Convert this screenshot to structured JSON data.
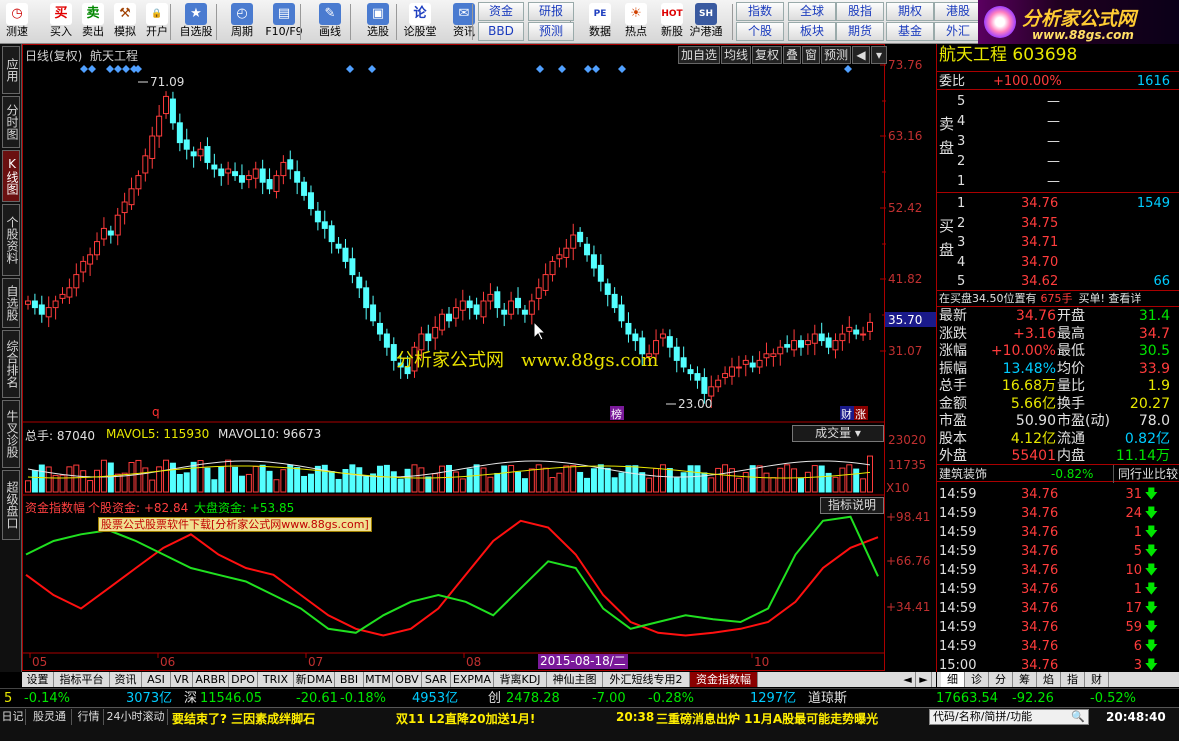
{
  "toolbar": {
    "buttons": [
      {
        "label": "测速",
        "icon": "clock-icon"
      },
      {
        "label": "买入",
        "icon": "buy-icon"
      },
      {
        "label": "卖出",
        "icon": "sell-icon"
      },
      {
        "label": "模拟",
        "icon": "hammer-icon"
      },
      {
        "label": "开户",
        "icon": "lock-icon"
      },
      {
        "label": "自选股",
        "icon": "star-icon"
      },
      {
        "label": "周期",
        "icon": "period-clock-icon"
      },
      {
        "label": "F10/F9",
        "icon": "f10-icon"
      },
      {
        "label": "画线",
        "icon": "pencil-icon"
      },
      {
        "label": "选股",
        "icon": "select-stock-icon"
      },
      {
        "label": "论股堂",
        "icon": "forum-icon"
      },
      {
        "label": "资讯",
        "icon": "news-icon"
      },
      {
        "label": "数据",
        "icon": "pe-icon"
      },
      {
        "label": "热点",
        "icon": "hot-icon"
      },
      {
        "label": "新股",
        "icon": "new-stock-icon"
      },
      {
        "label": "沪港通",
        "icon": "shhk-icon"
      }
    ],
    "small_buttons": [
      "资金",
      "研报",
      "BBD",
      "预测",
      "指数",
      "全球",
      "股指",
      "期权",
      "港股",
      "个股",
      "板块",
      "期货",
      "基金",
      "外汇"
    ],
    "logo_text": "分析家公式网",
    "logo_url": "www.88gs.com"
  },
  "left_tabs": [
    "应用",
    "分时图",
    "K线图",
    "个股资料",
    "自选股",
    "综合排名",
    "牛叉诊股",
    "超级盘口"
  ],
  "chart": {
    "title": "日线(复权)  航天工程",
    "tools": [
      "加自选",
      "均线",
      "复权",
      "叠",
      "窗",
      "预测"
    ],
    "price_axis": [
      "73.76",
      "63.16",
      "52.42",
      "41.82",
      "31.07"
    ],
    "current_price": "35.70",
    "high_label": "71.09",
    "low_label": "23.00",
    "watermark": "分析家公式网   www.88gs.com",
    "markers": {
      "q": "q",
      "bang": "榜",
      "cai": "财",
      "zhang": "涨"
    },
    "volume": {
      "label_total": "总手: 87040",
      "label_ma5": "MAVOL5: 115930",
      "label_ma10": "MAVOL10: 96673",
      "dropdown": "成交量",
      "axis": [
        "23020",
        "11735"
      ],
      "unit": "X10"
    },
    "indicator": {
      "name": "资金指数幅",
      "label_small": "个股资金: +82.84",
      "label_big": "大盘资金: +53.85",
      "button": "指标说明",
      "ad_text": "股票公式股票软件下载[分析家公式网www.88gs.com]",
      "axis": [
        "+98.41",
        "+66.76",
        "+34.41"
      ]
    },
    "x_axis": [
      "05",
      "06",
      "07",
      "08",
      "10"
    ],
    "cursor_date": "2015-08-18/二"
  },
  "chart_data": {
    "type": "line",
    "title": "",
    "ylim": [
      23.0,
      73.76
    ],
    "x": [
      "05",
      "06",
      "07",
      "08",
      "10"
    ],
    "series": [
      {
        "name": "个股资金",
        "values": [
          55,
          40,
          30,
          45,
          60,
          75,
          85,
          70,
          60,
          55,
          40,
          25,
          15,
          10,
          15,
          30,
          55,
          80,
          95,
          90,
          70,
          40,
          20,
          12,
          10,
          12,
          15,
          20,
          35,
          60,
          75,
          82.84
        ]
      },
      {
        "name": "大盘资金",
        "values": [
          70,
          80,
          85,
          88,
          80,
          70,
          60,
          55,
          50,
          40,
          30,
          15,
          12,
          25,
          35,
          40,
          35,
          25,
          45,
          65,
          60,
          30,
          15,
          20,
          25,
          22,
          20,
          30,
          70,
          95,
          98,
          53.85
        ]
      }
    ]
  },
  "right": {
    "stock_name": "航天工程",
    "stock_code": "603698",
    "wei_bi_label": "委比",
    "wei_bi": "+100.00%",
    "wei_cha": "1616",
    "sell_label": "卖盘",
    "buy_label": "买盘",
    "sell": [
      {
        "n": "5",
        "p": "—"
      },
      {
        "n": "4",
        "p": "—"
      },
      {
        "n": "3",
        "p": "—"
      },
      {
        "n": "2",
        "p": "—"
      },
      {
        "n": "1",
        "p": "—"
      }
    ],
    "buy": [
      {
        "n": "1",
        "p": "34.76",
        "v": "1549"
      },
      {
        "n": "2",
        "p": "34.75",
        "v": ""
      },
      {
        "n": "3",
        "p": "34.71",
        "v": ""
      },
      {
        "n": "4",
        "p": "34.70",
        "v": ""
      },
      {
        "n": "5",
        "p": "34.62",
        "v": "66"
      }
    ],
    "position_note": "在买盘34.50位置有",
    "position_vol": "675手",
    "position_action": "买单! 查看详",
    "quotes": [
      {
        "l1": "最新",
        "v1": "34.76",
        "l2": "开盘",
        "v2": "31.4"
      },
      {
        "l1": "涨跌",
        "v1": "+3.16",
        "l2": "最高",
        "v2": "34.7"
      },
      {
        "l1": "涨幅",
        "v1": "+10.00%",
        "l2": "最低",
        "v2": "30.5"
      },
      {
        "l1": "振幅",
        "v1": "13.48%",
        "l2": "均价",
        "v2": "33.9"
      },
      {
        "l1": "总手",
        "v1": "16.68万",
        "l2": "量比",
        "v2": "1.9"
      },
      {
        "l1": "金额",
        "v1": "5.66亿",
        "l2": "换手",
        "v2": "20.27"
      },
      {
        "l1": "市盈",
        "v1": "50.90",
        "l2": "市盈(动)",
        "v2": "78.0"
      },
      {
        "l1": "股本",
        "v1": "4.12亿",
        "l2": "流通",
        "v2": "0.82亿"
      },
      {
        "l1": "外盘",
        "v1": "55401",
        "l2": "内盘",
        "v2": "11.14万"
      }
    ],
    "sector": "建筑装饰",
    "sector_change": "-0.82%",
    "sector_btn": "同行业比较",
    "ticks": [
      {
        "t": "14:59",
        "p": "34.76",
        "v": "31"
      },
      {
        "t": "14:59",
        "p": "34.76",
        "v": "24"
      },
      {
        "t": "14:59",
        "p": "34.76",
        "v": "1"
      },
      {
        "t": "14:59",
        "p": "34.76",
        "v": "5"
      },
      {
        "t": "14:59",
        "p": "34.76",
        "v": "10"
      },
      {
        "t": "14:59",
        "p": "34.76",
        "v": "1"
      },
      {
        "t": "14:59",
        "p": "34.76",
        "v": "17"
      },
      {
        "t": "14:59",
        "p": "34.76",
        "v": "59"
      },
      {
        "t": "14:59",
        "p": "34.76",
        "v": "6"
      },
      {
        "t": "15:00",
        "p": "34.76",
        "v": "3"
      }
    ],
    "bottom_tabs": [
      "细",
      "诊",
      "分",
      "筹",
      "焰",
      "指",
      "财"
    ]
  },
  "bottom_tabs": [
    "设置",
    "指标平台",
    "资讯",
    "ASI",
    "VR",
    "ARBR",
    "DPO",
    "TRIX",
    "新DMA",
    "BBI",
    "MTM",
    "OBV",
    "SAR",
    "EXPMA",
    "背离KDJ",
    "神仙主图",
    "外汇短线专用2",
    "资金指数幅"
  ],
  "index_bar": {
    "items": [
      {
        "text": "5",
        "cls": "y"
      },
      {
        "text": "-0.14%",
        "cls": "g"
      },
      {
        "text": "3073亿",
        "cls": "c"
      },
      {
        "text": "深",
        "cls": "w"
      },
      {
        "text": "11546.05",
        "cls": "g"
      },
      {
        "text": "-20.61",
        "cls": "g"
      },
      {
        "text": "-0.18%",
        "cls": "g"
      },
      {
        "text": "4953亿",
        "cls": "c"
      },
      {
        "text": "创",
        "cls": "w"
      },
      {
        "text": "2478.28",
        "cls": "g"
      },
      {
        "text": "-7.00",
        "cls": "g"
      },
      {
        "text": "-0.28%",
        "cls": "g"
      },
      {
        "text": "1297亿",
        "cls": "c"
      },
      {
        "text": "道琼斯",
        "cls": "w"
      },
      {
        "text": "17663.54",
        "cls": "g"
      },
      {
        "text": "-92.26",
        "cls": "g"
      },
      {
        "text": "-0.52%",
        "cls": "g"
      }
    ]
  },
  "status": {
    "tabs": [
      "日记",
      "股灵通",
      "行情",
      "24小时滚动"
    ],
    "news1": "要结束了? 三因素成绊脚石",
    "news2": "双11 L2直降20加送1月!",
    "news3_time": "20:38",
    "news3": "三重磅消息出炉 11月A股最可能走势曝光",
    "search_placeholder": "代码/名称/简拼/功能",
    "clock": "20:48:40"
  }
}
